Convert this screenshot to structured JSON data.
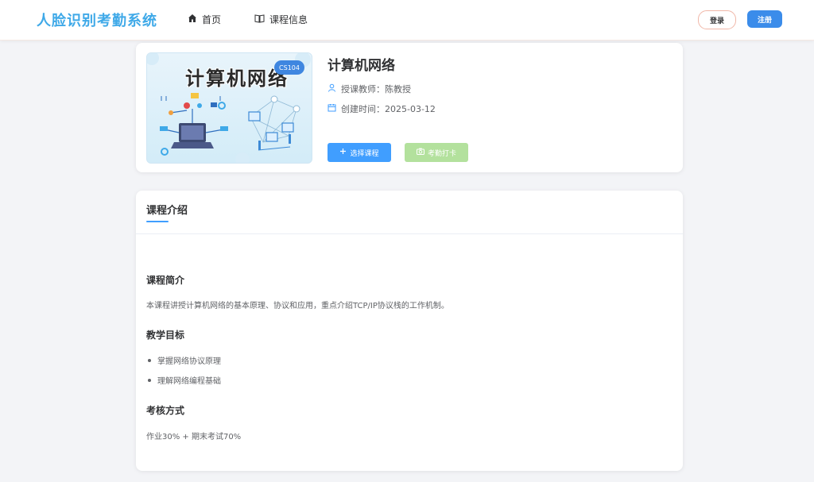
{
  "header": {
    "logo": "人脸识别考勤系统",
    "nav": [
      {
        "label": "首页",
        "icon": "home-icon"
      },
      {
        "label": "课程信息",
        "icon": "book-icon"
      }
    ],
    "login_label": "登录",
    "register_label": "注册"
  },
  "course": {
    "cover_title": "计算机网络",
    "code": "CS104",
    "title": "计算机网络",
    "teacher_label": "授课教师：",
    "teacher": "陈教授",
    "created_label": "创建时间：",
    "created": "2025-03-12",
    "select_label": "选择课程",
    "checkin_label": "考勤打卡"
  },
  "intro": {
    "tab_title": "课程介绍",
    "summary_heading": "课程简介",
    "summary_text": "本课程讲授计算机网络的基本原理、协议和应用，重点介绍TCP/IP协议栈的工作机制。",
    "goals_heading": "教学目标",
    "goals": [
      "掌握网络协议原理",
      "理解网络编程基础"
    ],
    "assessment_heading": "考核方式",
    "assessment_text": "作业30% + 期末考试70%"
  },
  "colors": {
    "accent": "#409eff",
    "logo": "#3fa9e8",
    "checkin_disabled": "#b3e19d"
  }
}
